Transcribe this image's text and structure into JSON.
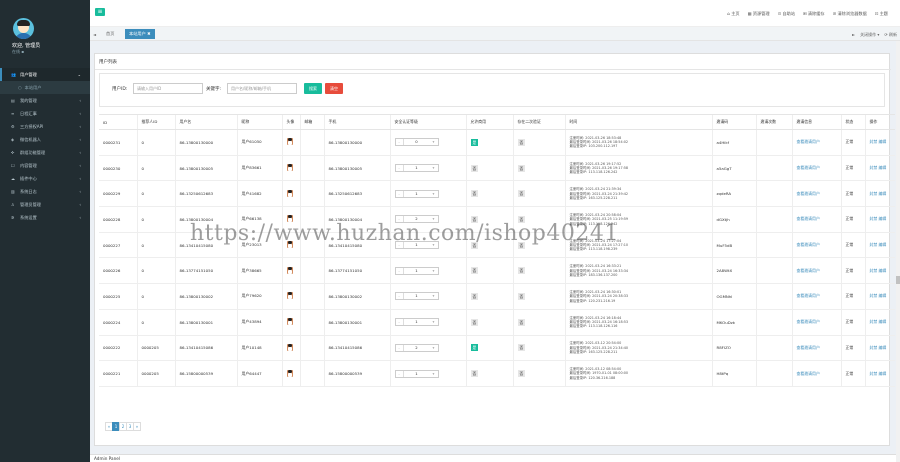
{
  "sidebar": {
    "user_name": "欢迎, 管理员",
    "user_status": "在线 ▪",
    "menu": [
      {
        "label": "用户管理",
        "icon": "users-icon",
        "active": true
      },
      {
        "label": "本站用户",
        "icon": "circle-icon",
        "sub": true
      },
      {
        "label": "我的管理",
        "icon": "book-icon"
      },
      {
        "label": "日程汇事",
        "icon": "list-icon"
      },
      {
        "label": "三方授权API",
        "icon": "gear-icon"
      },
      {
        "label": "微信机器人",
        "icon": "robot-icon"
      },
      {
        "label": "群组功能管理",
        "icon": "group-icon"
      },
      {
        "label": "内容管理",
        "icon": "file-icon"
      },
      {
        "label": "插件中心",
        "icon": "cloud-icon"
      },
      {
        "label": "系统日志",
        "icon": "log-icon"
      },
      {
        "label": "管理员管理",
        "icon": "user-icon"
      },
      {
        "label": "系统设置",
        "icon": "settings-icon"
      }
    ]
  },
  "topbar": {
    "toggle": "≡",
    "nav": [
      "⌂ 主页",
      "▦ 资源管理",
      "⊙ 自助站",
      "⊞ 清除缓存",
      "⊘ 清除浏览器数据",
      "⊡ 主题"
    ]
  },
  "tabs": {
    "prev": "◄",
    "home": "首页",
    "active": "本站用户 ✖",
    "next": "►",
    "actions": "关闭操作 ▾",
    "refresh": "⟳ 刷新"
  },
  "panel": {
    "title": "用户列表",
    "filter": {
      "uid_label": "用户ID:",
      "uid_placeholder": "请输入用户ID",
      "kw_label": "关键字:",
      "kw_placeholder": "用户名/昵称/邮箱/手机",
      "search_btn": "搜索",
      "clear_btn": "清空"
    }
  },
  "table": {
    "columns": [
      "ID",
      "推荐人ID",
      "用户名",
      "昵称",
      "头像",
      "邮箱",
      "手机",
      "安全认证等级",
      "允许商用",
      "存在二次验证",
      "时间",
      "邀请码",
      "邀请次数",
      "邀请信息",
      "状态",
      "操作"
    ],
    "rows": [
      {
        "id": "0000231",
        "ref": "0",
        "username": "86-13800130000",
        "nick": "用户61050",
        "email": "",
        "phone": "86-13800130000",
        "level": "0",
        "biz": "是",
        "twofa": "否",
        "log": [
          "注册时间: 2021-03-26 18:53:48",
          "最后登录时间: 2021-03-26 18:54:02",
          "最后登录IP: 103.200.112.197"
        ],
        "code": "a4Hikf",
        "count": "",
        "info": "查看邀请用户",
        "status": "正常",
        "ops": "封禁 编辑"
      },
      {
        "id": "0000230",
        "ref": "0",
        "username": "86-13800130005",
        "nick": "用户83661",
        "email": "",
        "phone": "86-13800130005",
        "level": "1",
        "biz": "否",
        "twofa": "否",
        "log": [
          "注册时间: 2021-03-26 19:17:52",
          "最后登录时间: 2021-03-26 19:17:58",
          "最后登录IP: 113.118.126.242"
        ],
        "code": "a5aGgT",
        "count": "",
        "info": "查看邀请用户",
        "status": "正常",
        "ops": "封禁 编辑"
      },
      {
        "id": "0000229",
        "ref": "0",
        "username": "86-13250612683",
        "nick": "用户41682",
        "email": "",
        "phone": "86-13250612683",
        "level": "1",
        "biz": "否",
        "twofa": "否",
        "log": [
          "注册时间: 2021-03-24 21:39:34",
          "最后登录时间: 2021-03-24 21:39:42",
          "最后登录IP: 163.125.228.211"
        ],
        "code": "zqdeRA",
        "count": "",
        "info": "查看邀请用户",
        "status": "正常",
        "ops": "封禁 编辑"
      },
      {
        "id": "0000228",
        "ref": "0",
        "username": "86-13800130004",
        "nick": "用户66138",
        "email": "",
        "phone": "86-13800130004",
        "level": "2",
        "biz": "否",
        "twofa": "否",
        "log": [
          "注册时间: 2021-03-24 20:58:04",
          "最后登录时间: 2021-03-25 11:19:59",
          "最后登录IP: 113.118.126.242"
        ],
        "code": "dGXtjh",
        "count": "",
        "info": "查看邀请用户",
        "status": "正常",
        "ops": "封禁 编辑"
      },
      {
        "id": "0000227",
        "ref": "0",
        "username": "86-13410415080",
        "nick": "用户23013",
        "email": "",
        "phone": "86-13410415080",
        "level": "1",
        "biz": "否",
        "twofa": "否",
        "log": [
          "注册时间: 2021-03-24 17:27:04",
          "最后登录时间: 2021-03-24 17:27:10",
          "最后登录IP: 113.118.198.239"
        ],
        "code": "MuF5dB",
        "count": "",
        "info": "查看邀请用户",
        "status": "正常",
        "ops": "封禁 编辑"
      },
      {
        "id": "0000226",
        "ref": "0",
        "username": "86-13774151050",
        "nick": "用户38665",
        "email": "",
        "phone": "86-13774151050",
        "level": "1",
        "biz": "否",
        "twofa": "否",
        "log": [
          "注册时间: 2021-03-24 16:33:21",
          "最后登录时间: 2021-03-24 16:33:34",
          "最后登录IP: 183.136.137.200"
        ],
        "code": "2A8WtX",
        "count": "",
        "info": "查看邀请用户",
        "status": "正常",
        "ops": "封禁 编辑"
      },
      {
        "id": "0000225",
        "ref": "0",
        "username": "86-13800130002",
        "nick": "用户79620",
        "email": "",
        "phone": "86-13800130002",
        "level": "1",
        "biz": "否",
        "twofa": "否",
        "log": [
          "注册时间: 2021-03-24 16:30:01",
          "最后登录时间: 2021-03-24 20:38:33",
          "最后登录IP: 120.231.216.19"
        ],
        "code": "OGMNhl",
        "count": "",
        "info": "查看邀请用户",
        "status": "正常",
        "ops": "封禁 编辑"
      },
      {
        "id": "0000224",
        "ref": "0",
        "username": "86-13800130001",
        "nick": "用户43894",
        "email": "",
        "phone": "86-13800130001",
        "level": "1",
        "biz": "否",
        "twofa": "否",
        "log": [
          "注册时间: 2021-03-24 16:18:44",
          "最后登录时间: 2021-03-24 16:18:53",
          "最后登录IP: 113.118.126.116"
        ],
        "code": "MKOuDzk",
        "count": "",
        "info": "查看邀请用户",
        "status": "正常",
        "ops": "封禁 编辑"
      },
      {
        "id": "0000222",
        "ref": "0000205",
        "username": "86-13410415086",
        "nick": "用户10148",
        "email": "",
        "phone": "86-13410415086",
        "level": "2",
        "biz": "是",
        "twofa": "否",
        "log": [
          "注册时间: 2021-03-12 20:54:00",
          "最后登录时间: 2021-03-24 21:34:40",
          "最后登录IP: 163.125.228.211"
        ],
        "code": "R8FIZO",
        "count": "",
        "info": "查看邀请用户",
        "status": "正常",
        "ops": "封禁 编辑"
      },
      {
        "id": "0000221",
        "ref": "0000205",
        "username": "86-15800000539",
        "nick": "用户64447",
        "email": "",
        "phone": "86-15800000539",
        "level": "1",
        "biz": "否",
        "twofa": "否",
        "log": [
          "注册时间: 2021-03-12 08:54:00",
          "最后登录时间: 1970-01-01 08:00:00",
          "最后登录IP: 120.36.216.188"
        ],
        "code": "H8tPq",
        "count": "",
        "info": "查看邀请用户",
        "status": "正常",
        "ops": "封禁 编辑"
      }
    ]
  },
  "pager": [
    "«",
    "1",
    "2",
    "3",
    "»"
  ],
  "footer": "Admin Panel",
  "watermark": "https://www.huzhan.com/ishop40241"
}
